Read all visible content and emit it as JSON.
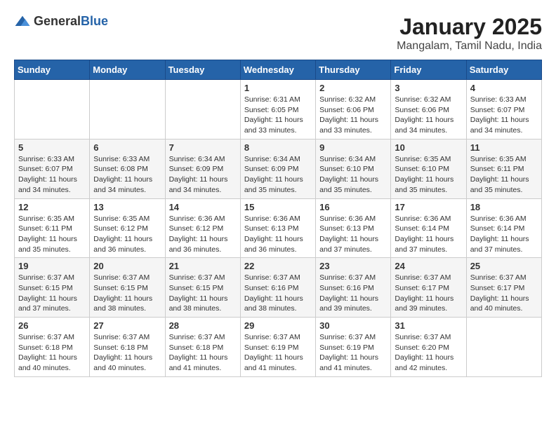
{
  "header": {
    "logo_general": "General",
    "logo_blue": "Blue",
    "month_year": "January 2025",
    "location": "Mangalam, Tamil Nadu, India"
  },
  "weekdays": [
    "Sunday",
    "Monday",
    "Tuesday",
    "Wednesday",
    "Thursday",
    "Friday",
    "Saturday"
  ],
  "weeks": [
    [
      {
        "day": "",
        "info": ""
      },
      {
        "day": "",
        "info": ""
      },
      {
        "day": "",
        "info": ""
      },
      {
        "day": "1",
        "info": "Sunrise: 6:31 AM\nSunset: 6:05 PM\nDaylight: 11 hours\nand 33 minutes."
      },
      {
        "day": "2",
        "info": "Sunrise: 6:32 AM\nSunset: 6:06 PM\nDaylight: 11 hours\nand 33 minutes."
      },
      {
        "day": "3",
        "info": "Sunrise: 6:32 AM\nSunset: 6:06 PM\nDaylight: 11 hours\nand 34 minutes."
      },
      {
        "day": "4",
        "info": "Sunrise: 6:33 AM\nSunset: 6:07 PM\nDaylight: 11 hours\nand 34 minutes."
      }
    ],
    [
      {
        "day": "5",
        "info": "Sunrise: 6:33 AM\nSunset: 6:07 PM\nDaylight: 11 hours\nand 34 minutes."
      },
      {
        "day": "6",
        "info": "Sunrise: 6:33 AM\nSunset: 6:08 PM\nDaylight: 11 hours\nand 34 minutes."
      },
      {
        "day": "7",
        "info": "Sunrise: 6:34 AM\nSunset: 6:09 PM\nDaylight: 11 hours\nand 34 minutes."
      },
      {
        "day": "8",
        "info": "Sunrise: 6:34 AM\nSunset: 6:09 PM\nDaylight: 11 hours\nand 35 minutes."
      },
      {
        "day": "9",
        "info": "Sunrise: 6:34 AM\nSunset: 6:10 PM\nDaylight: 11 hours\nand 35 minutes."
      },
      {
        "day": "10",
        "info": "Sunrise: 6:35 AM\nSunset: 6:10 PM\nDaylight: 11 hours\nand 35 minutes."
      },
      {
        "day": "11",
        "info": "Sunrise: 6:35 AM\nSunset: 6:11 PM\nDaylight: 11 hours\nand 35 minutes."
      }
    ],
    [
      {
        "day": "12",
        "info": "Sunrise: 6:35 AM\nSunset: 6:11 PM\nDaylight: 11 hours\nand 35 minutes."
      },
      {
        "day": "13",
        "info": "Sunrise: 6:35 AM\nSunset: 6:12 PM\nDaylight: 11 hours\nand 36 minutes."
      },
      {
        "day": "14",
        "info": "Sunrise: 6:36 AM\nSunset: 6:12 PM\nDaylight: 11 hours\nand 36 minutes."
      },
      {
        "day": "15",
        "info": "Sunrise: 6:36 AM\nSunset: 6:13 PM\nDaylight: 11 hours\nand 36 minutes."
      },
      {
        "day": "16",
        "info": "Sunrise: 6:36 AM\nSunset: 6:13 PM\nDaylight: 11 hours\nand 37 minutes."
      },
      {
        "day": "17",
        "info": "Sunrise: 6:36 AM\nSunset: 6:14 PM\nDaylight: 11 hours\nand 37 minutes."
      },
      {
        "day": "18",
        "info": "Sunrise: 6:36 AM\nSunset: 6:14 PM\nDaylight: 11 hours\nand 37 minutes."
      }
    ],
    [
      {
        "day": "19",
        "info": "Sunrise: 6:37 AM\nSunset: 6:15 PM\nDaylight: 11 hours\nand 37 minutes."
      },
      {
        "day": "20",
        "info": "Sunrise: 6:37 AM\nSunset: 6:15 PM\nDaylight: 11 hours\nand 38 minutes."
      },
      {
        "day": "21",
        "info": "Sunrise: 6:37 AM\nSunset: 6:15 PM\nDaylight: 11 hours\nand 38 minutes."
      },
      {
        "day": "22",
        "info": "Sunrise: 6:37 AM\nSunset: 6:16 PM\nDaylight: 11 hours\nand 38 minutes."
      },
      {
        "day": "23",
        "info": "Sunrise: 6:37 AM\nSunset: 6:16 PM\nDaylight: 11 hours\nand 39 minutes."
      },
      {
        "day": "24",
        "info": "Sunrise: 6:37 AM\nSunset: 6:17 PM\nDaylight: 11 hours\nand 39 minutes."
      },
      {
        "day": "25",
        "info": "Sunrise: 6:37 AM\nSunset: 6:17 PM\nDaylight: 11 hours\nand 40 minutes."
      }
    ],
    [
      {
        "day": "26",
        "info": "Sunrise: 6:37 AM\nSunset: 6:18 PM\nDaylight: 11 hours\nand 40 minutes."
      },
      {
        "day": "27",
        "info": "Sunrise: 6:37 AM\nSunset: 6:18 PM\nDaylight: 11 hours\nand 40 minutes."
      },
      {
        "day": "28",
        "info": "Sunrise: 6:37 AM\nSunset: 6:18 PM\nDaylight: 11 hours\nand 41 minutes."
      },
      {
        "day": "29",
        "info": "Sunrise: 6:37 AM\nSunset: 6:19 PM\nDaylight: 11 hours\nand 41 minutes."
      },
      {
        "day": "30",
        "info": "Sunrise: 6:37 AM\nSunset: 6:19 PM\nDaylight: 11 hours\nand 41 minutes."
      },
      {
        "day": "31",
        "info": "Sunrise: 6:37 AM\nSunset: 6:20 PM\nDaylight: 11 hours\nand 42 minutes."
      },
      {
        "day": "",
        "info": ""
      }
    ]
  ]
}
